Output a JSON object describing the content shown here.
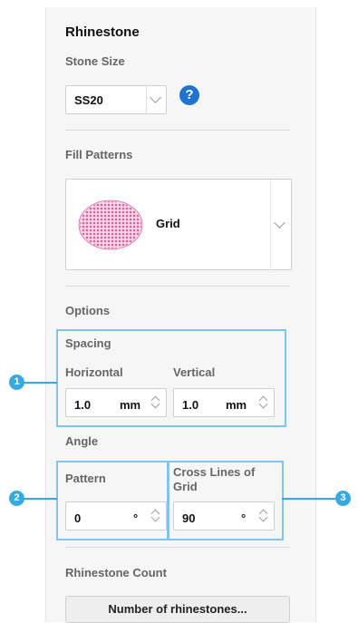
{
  "panel": {
    "title": "Rhinestone",
    "stone_size": {
      "label": "Stone Size",
      "selected": "SS20",
      "help": "?"
    },
    "fill_patterns": {
      "label": "Fill Patterns",
      "selected": "Grid"
    },
    "options": {
      "label": "Options",
      "spacing": {
        "label": "Spacing",
        "horizontal": {
          "label": "Horizontal",
          "value": "1.0",
          "unit": "mm"
        },
        "vertical": {
          "label": "Vertical",
          "value": "1.0",
          "unit": "mm"
        }
      },
      "angle": {
        "label": "Angle",
        "pattern": {
          "label": "Pattern",
          "value": "0",
          "unit": "°"
        },
        "cross_lines": {
          "label": "Cross Lines of\nGrid",
          "value": "90",
          "unit": "°"
        }
      }
    },
    "rhinestone_count": {
      "label": "Rhinestone Count",
      "button": "Number of rhinestones..."
    }
  },
  "callouts": [
    "1",
    "2",
    "3"
  ],
  "colors": {
    "accent": "#38a9df",
    "highlight": "#7fc6ea",
    "help": "#1f74d2",
    "dots": "#e0629e"
  }
}
